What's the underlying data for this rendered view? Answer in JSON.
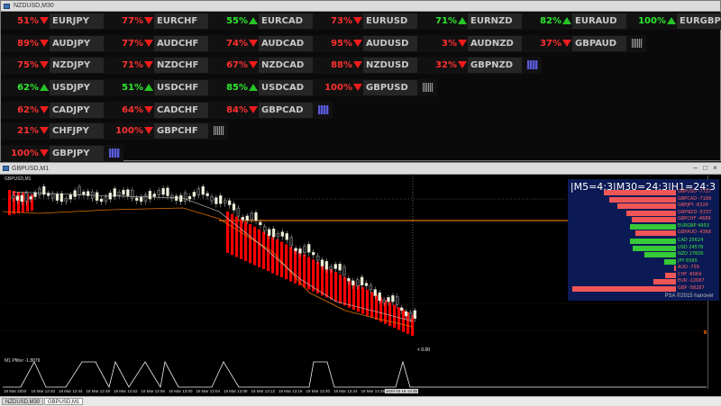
{
  "top_window": {
    "title": "NZDUSD,M30"
  },
  "matrix": [
    [
      {
        "pct": "51%",
        "dir": "down",
        "sym": "EURJPY"
      },
      {
        "pct": "77%",
        "dir": "down",
        "sym": "EURCHF"
      },
      {
        "pct": "55%",
        "dir": "up",
        "sym": "EURCAD"
      },
      {
        "pct": "73%",
        "dir": "down",
        "sym": "EURUSD"
      },
      {
        "pct": "71%",
        "dir": "up",
        "sym": "EURNZD"
      },
      {
        "pct": "82%",
        "dir": "up",
        "sym": "EURAUD"
      },
      {
        "pct": "100%",
        "dir": "up",
        "sym": "EURGBP"
      }
    ],
    [
      {
        "pct": "89%",
        "dir": "down",
        "sym": "AUDJPY"
      },
      {
        "pct": "77%",
        "dir": "down",
        "sym": "AUDCHF"
      },
      {
        "pct": "74%",
        "dir": "down",
        "sym": "AUDCAD"
      },
      {
        "pct": "95%",
        "dir": "down",
        "sym": "AUDUSD"
      },
      {
        "pct": "3%",
        "dir": "down",
        "sym": "AUDNZD"
      },
      {
        "pct": "37%",
        "dir": "down",
        "sym": "GBPAUD"
      }
    ],
    [
      {
        "pct": "75%",
        "dir": "down",
        "sym": "NZDJPY"
      },
      {
        "pct": "71%",
        "dir": "down",
        "sym": "NZDCHF"
      },
      {
        "pct": "67%",
        "dir": "down",
        "sym": "NZDCAD"
      },
      {
        "pct": "88%",
        "dir": "down",
        "sym": "NZDUSD"
      },
      {
        "pct": "32%",
        "dir": "down",
        "sym": "GBPNZD"
      }
    ],
    [
      {
        "pct": "62%",
        "dir": "up",
        "sym": "USDJPY"
      },
      {
        "pct": "51%",
        "dir": "up",
        "sym": "USDCHF"
      },
      {
        "pct": "85%",
        "dir": "up",
        "sym": "USDCAD"
      },
      {
        "pct": "100%",
        "dir": "down",
        "sym": "GBPUSD"
      }
    ],
    [
      {
        "pct": "62%",
        "dir": "down",
        "sym": "CADJPY"
      },
      {
        "pct": "64%",
        "dir": "down",
        "sym": "CADCHF"
      },
      {
        "pct": "84%",
        "dir": "down",
        "sym": "GBPCAD"
      }
    ],
    [
      {
        "pct": "21%",
        "dir": "down",
        "sym": "CHFJPY"
      },
      {
        "pct": "100%",
        "dir": "down",
        "sym": "GBPCHF"
      }
    ],
    [
      {
        "pct": "100%",
        "dir": "down",
        "sym": "GBPJPY"
      }
    ]
  ],
  "colors": {
    "up": "#27c427",
    "down": "#ee1c1c",
    "pct_up": "#2ee82e",
    "pct_down": "#ff3030",
    "bull_candle": "#f2f2d8",
    "bear_candle": "#ff0000",
    "panel_bg": "#0b1a55"
  },
  "chart_window": {
    "title": "GBPUSD,M1",
    "plot_label": "GBPUSD,M1",
    "indicator_label": "M1 Pfilter -1.8879",
    "price_marker": "< 0.00",
    "crosshair_label": "2020.03.18 13:35",
    "x_ticks": [
      "18 Mar 2020",
      "18 Mar 12:40",
      "18 Mar 12:44",
      "18 Mar 12:48",
      "18 Mar 12:52",
      "18 Mar 12:56",
      "18 Mar 13:00",
      "18 Mar 13:04",
      "18 Mar 13:08",
      "18 Mar 13:12",
      "18 Mar 13:16",
      "18 Mar 13:20",
      "18 Mar 13:24",
      "18 Mar 13:28"
    ]
  },
  "panel": {
    "header": "|M5=4:3|M30=24:3|H1=24:3",
    "pairs": [
      {
        "label": "GBPUSD -7727",
        "value": -7727,
        "color": "#ff6060"
      },
      {
        "label": "GBPCAD -7189",
        "value": -7189,
        "color": "#ff6060"
      },
      {
        "label": "GBPJPY -6326",
        "value": -6326,
        "color": "#ff6060"
      },
      {
        "label": "GBPNZD -5337",
        "value": -5337,
        "color": "#ff6060"
      },
      {
        "label": "GBPCHF -4689",
        "value": -4689,
        "color": "#ff6060"
      },
      {
        "label": "EURGBP 4953",
        "value": 4953,
        "color": "#3ee83e"
      },
      {
        "label": "GBPAUD -4368",
        "value": -4368,
        "color": "#ff6060"
      }
    ],
    "currencies": [
      {
        "label": "CAD 25624",
        "value": 25624,
        "color": "#3ee83e"
      },
      {
        "label": "USD 24578",
        "value": 24578,
        "color": "#3ee83e"
      },
      {
        "label": "NZD 17606",
        "value": 17606,
        "color": "#3ee83e"
      },
      {
        "label": "JPY 6565",
        "value": 6565,
        "color": "#3ee83e"
      },
      {
        "label": "AUD -759",
        "value": -759,
        "color": "#ff6060"
      },
      {
        "label": "CHF -6064",
        "value": -6064,
        "color": "#ff6060"
      },
      {
        "label": "EUR -12687",
        "value": -12687,
        "color": "#ff6060"
      },
      {
        "label": "GBP -58287",
        "value": -58287,
        "color": "#ff6060"
      }
    ],
    "credit": "PSA ©2015 hanover"
  },
  "taskbar": {
    "tabs": [
      "NZDUSD,M30",
      "GBPUSD,M1"
    ],
    "active": 1
  }
}
